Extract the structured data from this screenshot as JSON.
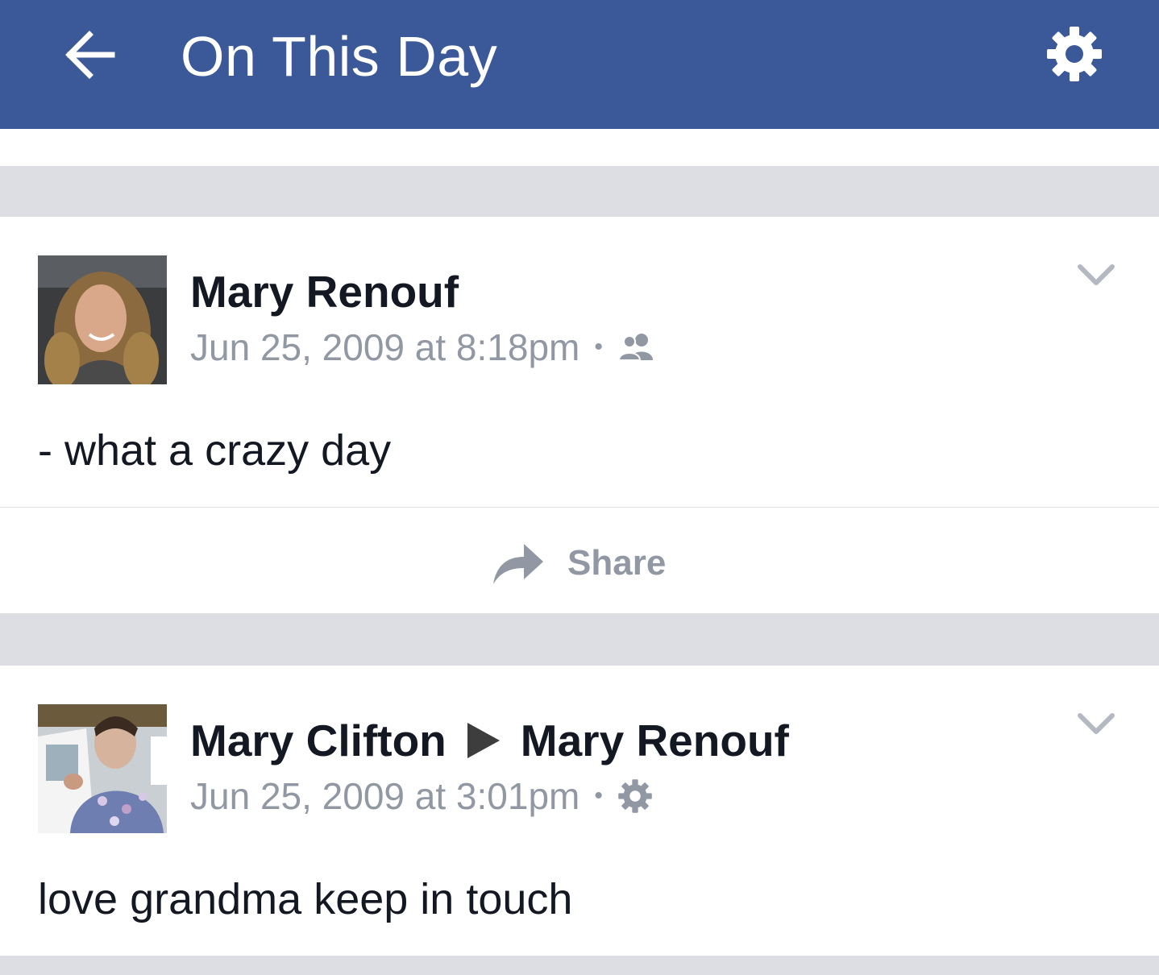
{
  "header": {
    "title": "On This Day",
    "back_icon": "arrow-left-icon",
    "settings_icon": "gear-icon",
    "background": "#3b5998"
  },
  "posts": [
    {
      "author": "Mary Renouf",
      "timestamp": "Jun 25, 2009 at 8:18pm",
      "separator": "•",
      "audience_icon": "friends-icon",
      "text": "- what a crazy day",
      "action": "Share"
    },
    {
      "author": "Mary Clifton",
      "recipient": "Mary Renouf",
      "timestamp": "Jun 25, 2009 at 3:01pm",
      "separator": "•",
      "audience_icon": "gear-icon",
      "text": "love grandma keep in touch"
    }
  ],
  "colors": {
    "feed_background": "#dcdee3",
    "meta_text": "#9197a3",
    "primary_text": "#141823"
  }
}
